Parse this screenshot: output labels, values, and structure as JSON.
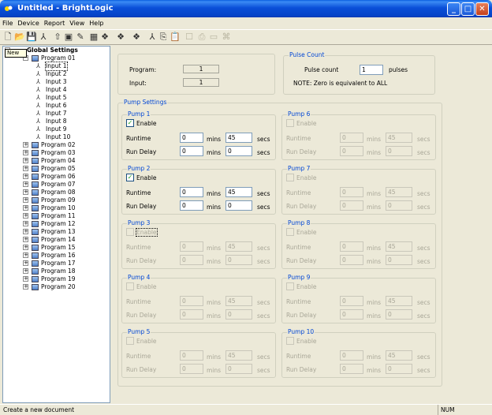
{
  "window": {
    "title": "Untitled - BrightLogic"
  },
  "menu": [
    "File",
    "Device",
    "Report",
    "View",
    "Help"
  ],
  "tooltip": "New",
  "tree": {
    "root": "Global Settings",
    "program01": "Program 01",
    "inputs": [
      "Input 1",
      "Input 2",
      "Input 3",
      "Input 4",
      "Input 5",
      "Input 6",
      "Input 7",
      "Input 8",
      "Input 9",
      "Input 10"
    ],
    "programs": [
      "Program 02",
      "Program 03",
      "Program 04",
      "Program 05",
      "Program 06",
      "Program 07",
      "Program 08",
      "Program 09",
      "Program 10",
      "Program 11",
      "Program 12",
      "Program 13",
      "Program 14",
      "Program 15",
      "Program 16",
      "Program 17",
      "Program 18",
      "Program 19",
      "Program 20"
    ]
  },
  "info": {
    "program_label": "Program:",
    "program_value": "1",
    "input_label": "Input:",
    "input_value": "1"
  },
  "pulse": {
    "group": "Pulse Count",
    "label": "Pulse count",
    "value": "1",
    "unit": "pulses",
    "note": "NOTE: Zero is equivalent to ALL"
  },
  "pump_settings_label": "Pump Settings",
  "labels": {
    "enable": "Enable",
    "runtime": "Runtime",
    "run_delay": "Run Delay",
    "mins": "mins",
    "secs": "secs"
  },
  "pumps": [
    {
      "title": "Pump 1",
      "enabled": true,
      "rt_mins": "0",
      "rt_secs": "45",
      "rd_mins": "0",
      "rd_secs": "0"
    },
    {
      "title": "Pump 2",
      "enabled": true,
      "rt_mins": "0",
      "rt_secs": "45",
      "rd_mins": "0",
      "rd_secs": "0"
    },
    {
      "title": "Pump 3",
      "enabled": false,
      "rt_mins": "0",
      "rt_secs": "45",
      "rd_mins": "0",
      "rd_secs": "0"
    },
    {
      "title": "Pump 4",
      "enabled": false,
      "rt_mins": "0",
      "rt_secs": "45",
      "rd_mins": "0",
      "rd_secs": "0"
    },
    {
      "title": "Pump 5",
      "enabled": false,
      "rt_mins": "0",
      "rt_secs": "45",
      "rd_mins": "0",
      "rd_secs": "0"
    },
    {
      "title": "Pump 6",
      "enabled": false,
      "rt_mins": "0",
      "rt_secs": "45",
      "rd_mins": "0",
      "rd_secs": "0"
    },
    {
      "title": "Pump 7",
      "enabled": false,
      "rt_mins": "0",
      "rt_secs": "45",
      "rd_mins": "0",
      "rd_secs": "0"
    },
    {
      "title": "Pump 8",
      "enabled": false,
      "rt_mins": "0",
      "rt_secs": "45",
      "rd_mins": "0",
      "rd_secs": "0"
    },
    {
      "title": "Pump 9",
      "enabled": false,
      "rt_mins": "0",
      "rt_secs": "45",
      "rd_mins": "0",
      "rd_secs": "0"
    },
    {
      "title": "Pump 10",
      "enabled": false,
      "rt_mins": "0",
      "rt_secs": "45",
      "rd_mins": "0",
      "rd_secs": "0"
    }
  ],
  "status": {
    "text": "Create a new document",
    "num": "NUM"
  }
}
